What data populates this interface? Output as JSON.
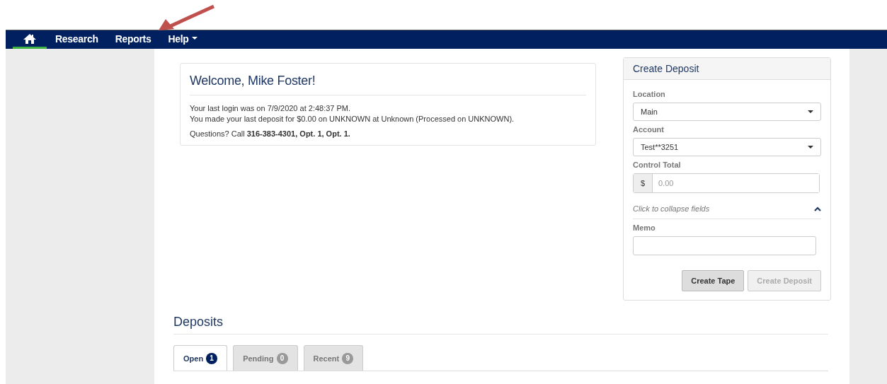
{
  "nav": {
    "items": [
      {
        "kind": "home",
        "selected": true
      },
      {
        "kind": "text",
        "label": "Research",
        "selected": false
      },
      {
        "kind": "text",
        "label": "Reports",
        "selected": false
      },
      {
        "kind": "menu",
        "label": "Help",
        "selected": false
      }
    ]
  },
  "welcome": {
    "title": "Welcome, Mike Foster!",
    "lines": [
      "Your last login was on 7/9/2020 at 2:48:37 PM.",
      "You made your last deposit for $0.00 on UNKNOWN at Unknown (Processed on UNKNOWN)."
    ],
    "questions": "Questions? Call **316-383-4301, Opt. 1, Opt. 1.**"
  },
  "create_deposit": {
    "title": "Create Deposit",
    "location": {
      "label": "Location",
      "value": "Main"
    },
    "account": {
      "label": "Account",
      "value": "Test**3251"
    },
    "control_total": {
      "label": "Control Total",
      "prefix": "$",
      "placeholder": "0.00"
    },
    "collapse": {
      "label": "Click to collapse fields",
      "expanded": true
    },
    "memo": {
      "label": "Memo"
    },
    "buttons": [
      {
        "label": "Create Tape",
        "disabled": false
      },
      {
        "label": "Create Deposit",
        "disabled": true
      }
    ]
  },
  "deposits": {
    "title": "Deposits",
    "tabs": [
      {
        "label": "Open",
        "count": "1",
        "selected": true
      },
      {
        "label": "Pending",
        "count": "0",
        "selected": false
      },
      {
        "label": "Recent",
        "count": "9",
        "selected": false
      }
    ]
  }
}
